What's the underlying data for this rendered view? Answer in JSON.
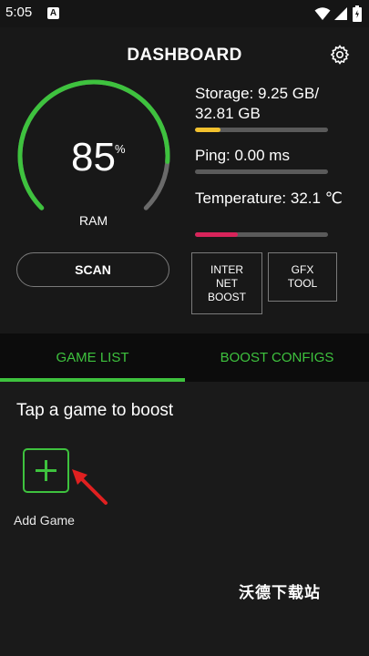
{
  "status_bar": {
    "time": "5:05",
    "notification_glyph": "A"
  },
  "header": {
    "title": "DASHBOARD"
  },
  "gauge": {
    "value": "85",
    "unit": "%",
    "label": "RAM",
    "fraction": 0.85,
    "color": "#3ec23e"
  },
  "stats": {
    "storage": {
      "label": "Storage: 9.25 GB/ 32.81 GB",
      "fraction": 0.19,
      "color": "#f2c12e"
    },
    "ping": {
      "label": "Ping: 0.00 ms",
      "fraction": 0.0,
      "color": "#3ec23e"
    },
    "temperature": {
      "label": "Temperature: 32.1 ℃",
      "fraction": 0.32,
      "color": "#d8245a"
    }
  },
  "buttons": {
    "scan": "SCAN",
    "internet_boost": "INTER NET BOOST",
    "gfx_tool": "GFX TOOL"
  },
  "tabs": [
    {
      "label": "GAME LIST",
      "active": true
    },
    {
      "label": "BOOST CONFIGS",
      "active": false
    }
  ],
  "content": {
    "hint": "Tap a game to boost",
    "add_game_label": "Add Game"
  },
  "watermark": "沃德下载站",
  "colors": {
    "accent": "#3ec23e",
    "background": "#181818",
    "annotation": "#e02020"
  }
}
